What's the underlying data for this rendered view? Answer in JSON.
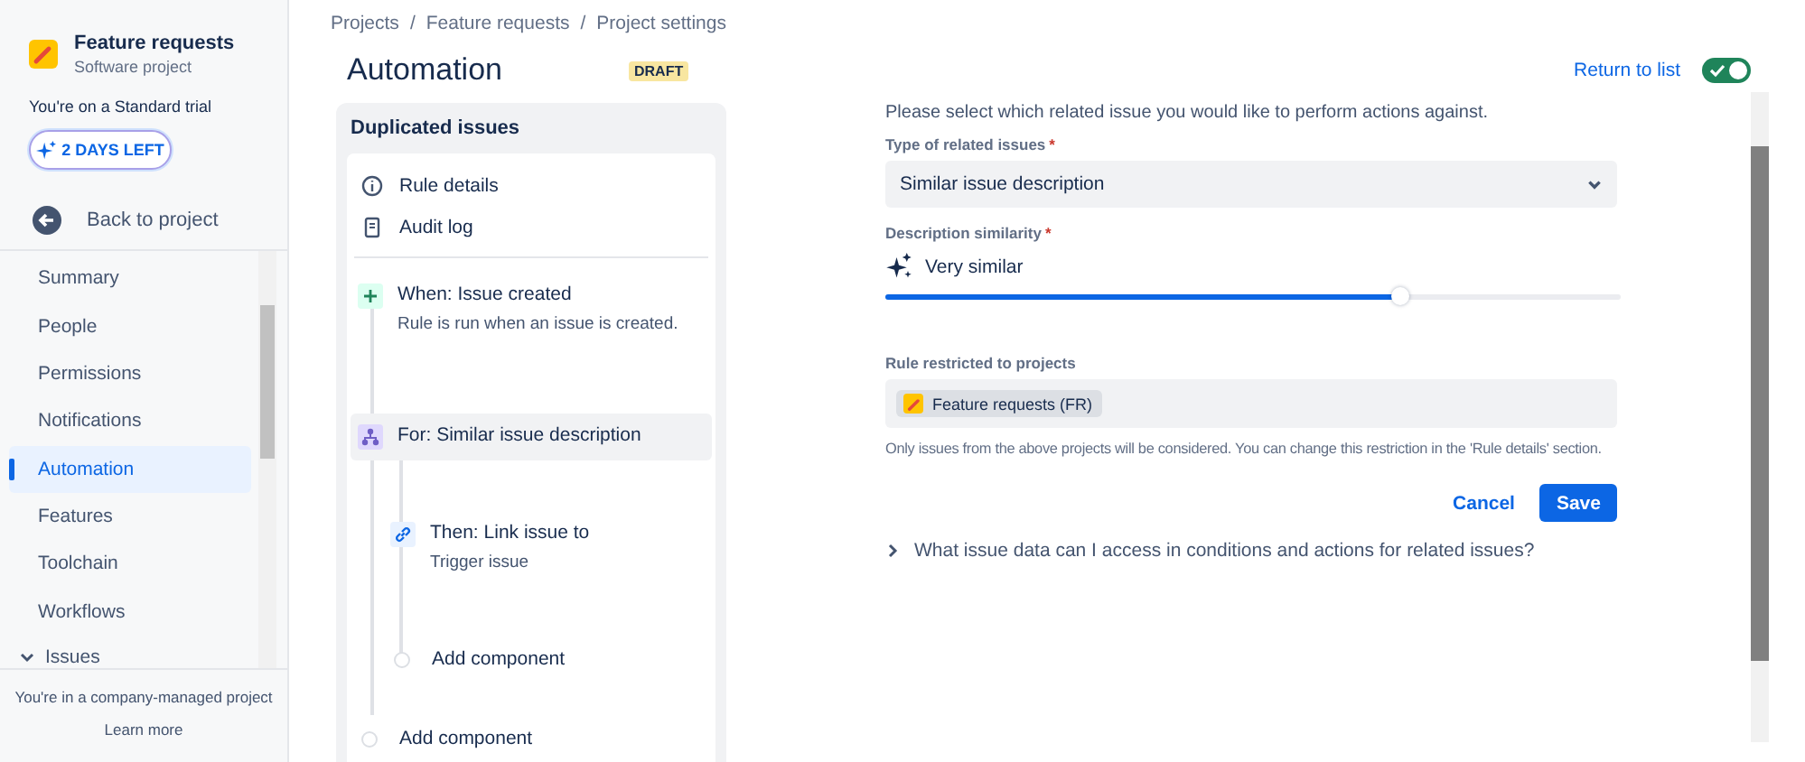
{
  "sidebar": {
    "project": {
      "name": "Feature requests",
      "type": "Software project"
    },
    "trial_text": "You're on a Standard trial",
    "trial_button": "2 DAYS LEFT",
    "back_link": "Back to project",
    "nav_items": [
      {
        "label": "Summary",
        "selected": false
      },
      {
        "label": "People",
        "selected": false
      },
      {
        "label": "Permissions",
        "selected": false
      },
      {
        "label": "Notifications",
        "selected": false
      },
      {
        "label": "Automation",
        "selected": true
      },
      {
        "label": "Features",
        "selected": false
      },
      {
        "label": "Toolchain",
        "selected": false
      },
      {
        "label": "Workflows",
        "selected": false
      }
    ],
    "nav_group": {
      "label": "Issues",
      "expanded": true
    },
    "footer_text": "You're in a company-managed project",
    "footer_link": "Learn more"
  },
  "breadcrumbs": [
    "Projects",
    "Feature requests",
    "Project settings"
  ],
  "breadcrumb_separator": "/",
  "header": {
    "title": "Automation",
    "status_badge": "DRAFT",
    "return_link": "Return to list",
    "toggle_on": true
  },
  "rule": {
    "title": "Duplicated issues",
    "menu": [
      {
        "kind": "info",
        "label": "Rule details"
      },
      {
        "kind": "log",
        "label": "Audit log"
      }
    ],
    "components": [
      {
        "kind": "trigger",
        "title": "When: Issue created",
        "description": "Rule is run when an issue is created.",
        "selected": false
      },
      {
        "kind": "branch",
        "title": "For: Similar issue description",
        "selected": true,
        "children": [
          {
            "kind": "action",
            "title": "Then: Link issue to",
            "description": "Trigger issue",
            "selected": false
          },
          {
            "kind": "add",
            "title": "Add component",
            "selected": false
          }
        ]
      },
      {
        "kind": "add",
        "title": "Add component",
        "selected": false
      }
    ]
  },
  "form": {
    "intro": "Please select which related issue you would like to perform actions against.",
    "type_field": {
      "label": "Type of related issues",
      "required_mark": "*",
      "value": "Similar issue description"
    },
    "similarity": {
      "label": "Description similarity",
      "required_mark": "*",
      "value": "Very similar",
      "level": 0.7
    },
    "projects": {
      "label": "Rule restricted to projects",
      "tags": [
        {
          "label": "Feature requests (FR)"
        }
      ],
      "help": "Only issues from the above projects will be considered. You can change this restriction in the 'Rule details' section."
    },
    "buttons": {
      "cancel": "Cancel",
      "save": "Save"
    },
    "disclosure": {
      "label": "What issue data can I access in conditions and actions for related issues?",
      "expanded": false
    }
  }
}
